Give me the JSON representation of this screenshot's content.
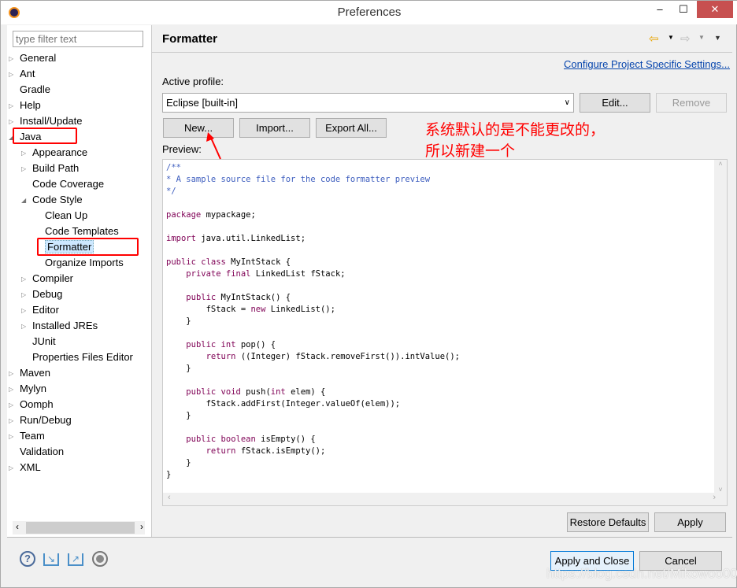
{
  "window": {
    "title": "Preferences",
    "minimize": "–",
    "maximize": "☐",
    "close": "✕",
    "app_icon": "eclipse-icon"
  },
  "sidebar": {
    "filter_placeholder": "type filter text",
    "items": [
      {
        "label": "General",
        "level": 0,
        "twisty": "collapsed"
      },
      {
        "label": "Ant",
        "level": 0,
        "twisty": "collapsed"
      },
      {
        "label": "Gradle",
        "level": 0,
        "twisty": "none"
      },
      {
        "label": "Help",
        "level": 0,
        "twisty": "collapsed"
      },
      {
        "label": "Install/Update",
        "level": 0,
        "twisty": "collapsed"
      },
      {
        "label": "Java",
        "level": 0,
        "twisty": "expanded"
      },
      {
        "label": "Appearance",
        "level": 1,
        "twisty": "collapsed"
      },
      {
        "label": "Build Path",
        "level": 1,
        "twisty": "collapsed"
      },
      {
        "label": "Code Coverage",
        "level": 1,
        "twisty": "none"
      },
      {
        "label": "Code Style",
        "level": 1,
        "twisty": "expanded"
      },
      {
        "label": "Clean Up",
        "level": 2,
        "twisty": "none"
      },
      {
        "label": "Code Templates",
        "level": 2,
        "twisty": "none"
      },
      {
        "label": "Formatter",
        "level": 2,
        "twisty": "none",
        "selected": true
      },
      {
        "label": "Organize Imports",
        "level": 2,
        "twisty": "none"
      },
      {
        "label": "Compiler",
        "level": 1,
        "twisty": "collapsed"
      },
      {
        "label": "Debug",
        "level": 1,
        "twisty": "collapsed"
      },
      {
        "label": "Editor",
        "level": 1,
        "twisty": "collapsed"
      },
      {
        "label": "Installed JREs",
        "level": 1,
        "twisty": "collapsed"
      },
      {
        "label": "JUnit",
        "level": 1,
        "twisty": "none"
      },
      {
        "label": "Properties Files Editor",
        "level": 1,
        "twisty": "none"
      },
      {
        "label": "Maven",
        "level": 0,
        "twisty": "collapsed"
      },
      {
        "label": "Mylyn",
        "level": 0,
        "twisty": "collapsed"
      },
      {
        "label": "Oomph",
        "level": 0,
        "twisty": "collapsed"
      },
      {
        "label": "Run/Debug",
        "level": 0,
        "twisty": "collapsed"
      },
      {
        "label": "Team",
        "level": 0,
        "twisty": "collapsed"
      },
      {
        "label": "Validation",
        "level": 0,
        "twisty": "none"
      },
      {
        "label": "XML",
        "level": 0,
        "twisty": "collapsed"
      }
    ]
  },
  "page": {
    "title": "Formatter",
    "configure_link": "Configure Project Specific Settings...",
    "active_profile_label": "Active profile:",
    "profile_value": "Eclipse [built-in]",
    "edit": "Edit...",
    "remove": "Remove",
    "new": "New...",
    "import": "Import...",
    "export_all": "Export All...",
    "preview_label": "Preview:",
    "restore_defaults": "Restore Defaults",
    "apply": "Apply"
  },
  "preview_code": [
    [
      [
        "/**",
        "cm"
      ]
    ],
    [
      [
        "* A sample source file for the code formatter preview",
        "cm"
      ]
    ],
    [
      [
        "*/",
        "cm"
      ]
    ],
    [],
    [
      [
        "package",
        "kw"
      ],
      [
        " mypackage;",
        ""
      ]
    ],
    [],
    [
      [
        "import",
        "kw"
      ],
      [
        " java.util.LinkedList;",
        ""
      ]
    ],
    [],
    [
      [
        "public class",
        "kw"
      ],
      [
        " MyIntStack {",
        ""
      ]
    ],
    [
      [
        "    ",
        ""
      ],
      [
        "private final",
        "kw"
      ],
      [
        " LinkedList fStack;",
        ""
      ]
    ],
    [],
    [
      [
        "    ",
        ""
      ],
      [
        "public",
        "kw"
      ],
      [
        " MyIntStack() {",
        ""
      ]
    ],
    [
      [
        "        fStack = ",
        ""
      ],
      [
        "new",
        "kw"
      ],
      [
        " LinkedList();",
        ""
      ]
    ],
    [
      [
        "    }",
        ""
      ]
    ],
    [],
    [
      [
        "    ",
        ""
      ],
      [
        "public int",
        "kw"
      ],
      [
        " pop() {",
        ""
      ]
    ],
    [
      [
        "        ",
        ""
      ],
      [
        "return",
        "kw"
      ],
      [
        " ((Integer) fStack.removeFirst()).intValue();",
        ""
      ]
    ],
    [
      [
        "    }",
        ""
      ]
    ],
    [],
    [
      [
        "    ",
        ""
      ],
      [
        "public void",
        "kw"
      ],
      [
        " push(",
        ""
      ],
      [
        "int",
        "kw"
      ],
      [
        " elem) {",
        ""
      ]
    ],
    [
      [
        "        fStack.addFirst(Integer.valueOf(elem));",
        ""
      ]
    ],
    [
      [
        "    }",
        ""
      ]
    ],
    [],
    [
      [
        "    ",
        ""
      ],
      [
        "public boolean",
        "kw"
      ],
      [
        " isEmpty() {",
        ""
      ]
    ],
    [
      [
        "        ",
        ""
      ],
      [
        "return",
        "kw"
      ],
      [
        " fStack.isEmpty();",
        ""
      ]
    ],
    [
      [
        "    }",
        ""
      ]
    ],
    [
      [
        "}",
        ""
      ]
    ]
  ],
  "footer": {
    "apply_and_close": "Apply and Close",
    "cancel": "Cancel",
    "icons": [
      "help-icon",
      "import-icon",
      "export-icon",
      "record-icon"
    ]
  },
  "annotation": {
    "note_line1": "系统默认的是不能更改的，",
    "note_line2": "所以新建一个",
    "color": "#ff0000"
  },
  "watermark": "https://blog.csdn.net/Mikowoo007",
  "colors": {
    "keyword": "#7f0055",
    "comment": "#3f5fbf",
    "link": "#0645ad",
    "selection": "#cde8ff"
  }
}
